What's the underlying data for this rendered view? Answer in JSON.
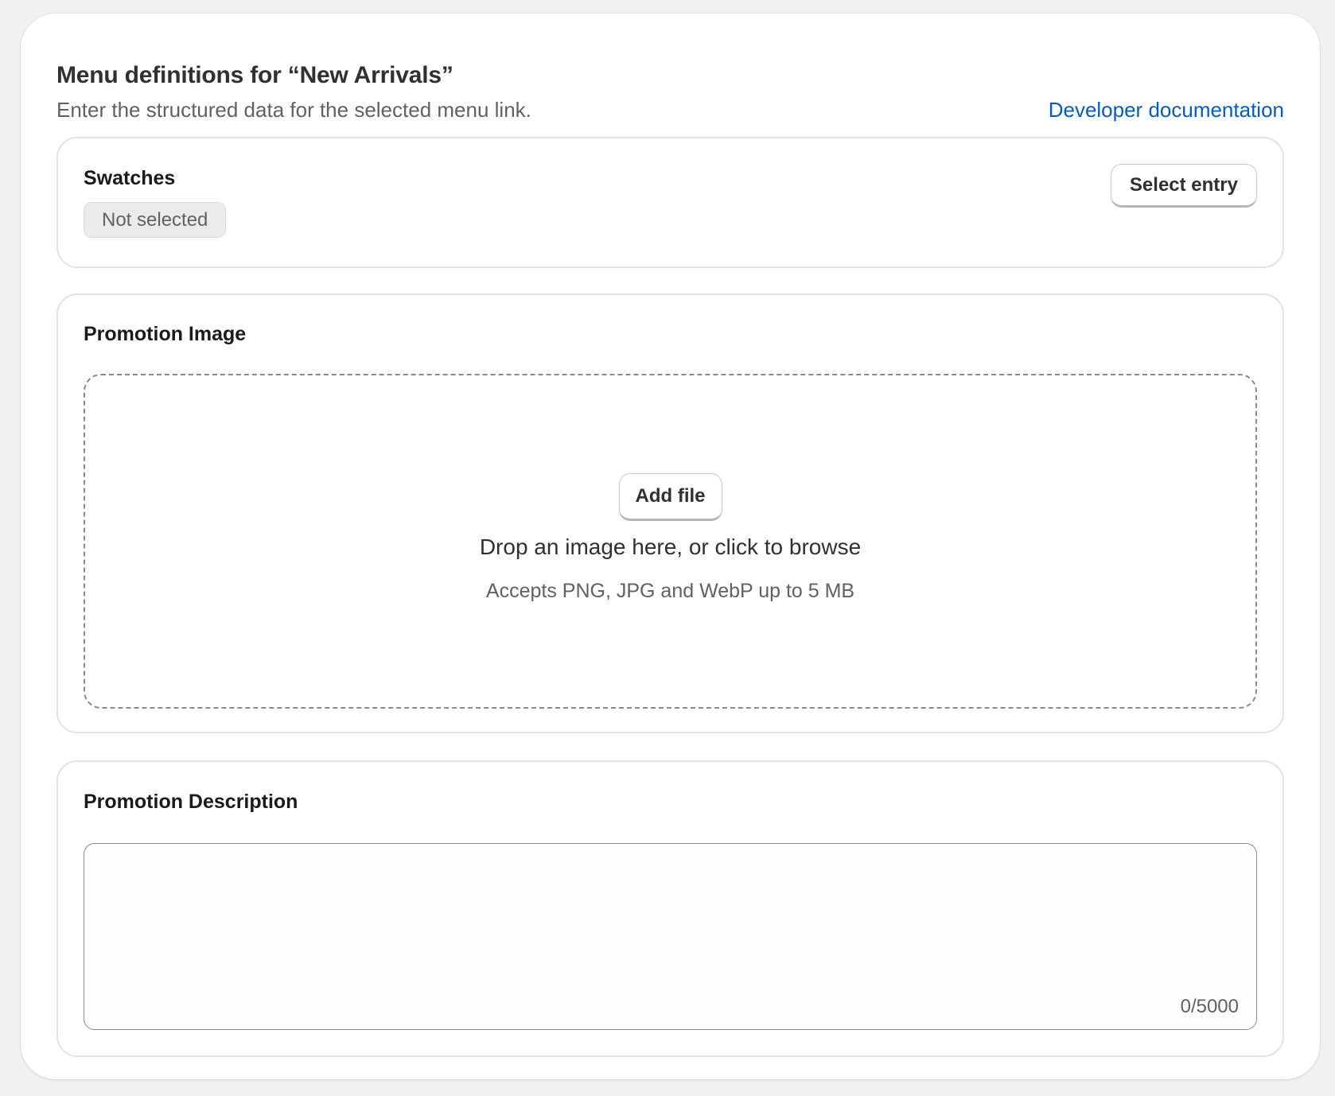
{
  "header": {
    "title": "Menu definitions for “New Arrivals”",
    "subtitle": "Enter the structured data for the selected menu link.",
    "doc_link": "Developer documentation"
  },
  "swatches": {
    "title": "Swatches",
    "status": "Not selected",
    "select_button": "Select entry"
  },
  "promotion_image": {
    "title": "Promotion Image",
    "add_file_button": "Add file",
    "drop_hint": "Drop an image here, or click to browse",
    "accepts": "Accepts PNG, JPG and WebP up to 5 MB"
  },
  "promotion_description": {
    "title": "Promotion Description",
    "value": "",
    "counter": "0/5000"
  },
  "colors": {
    "link": "#005bd3",
    "panel_background": "#ffffff",
    "page_background": "#f1f1f1",
    "badge_background": "#ebebeb"
  }
}
